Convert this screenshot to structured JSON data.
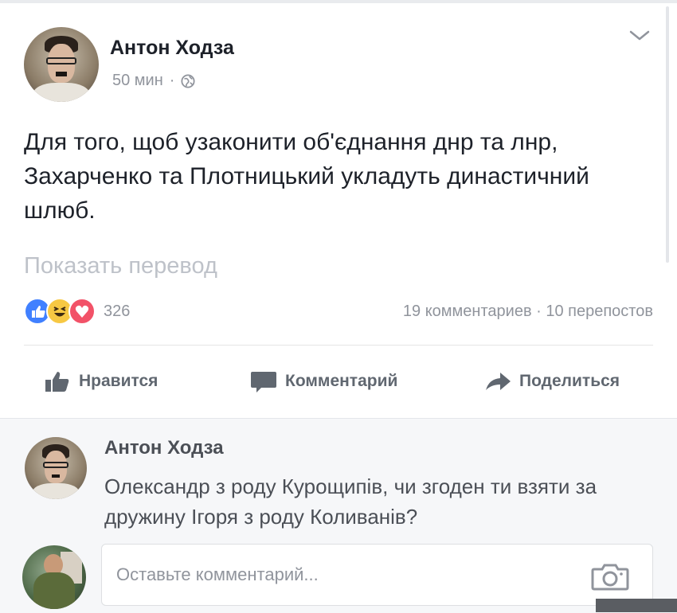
{
  "post": {
    "author": "Антон Ходза",
    "time": "50 мин",
    "separator": "·",
    "text": "Для того, щоб узаконити об'єднання днр та лнр, Захарченко та Плотницький укладуть династичний шлюб.",
    "translate_link": "Показать перевод",
    "reaction_count": "326",
    "stats": "19 комментариев · 10 перепостов",
    "reactions": [
      "like",
      "haha",
      "love"
    ]
  },
  "actions": {
    "like": "Нравится",
    "comment": "Комментарий",
    "share": "Поделиться"
  },
  "comment": {
    "author": "Антон Ходза",
    "text": "Олександр з роду Курощипів, чи згоден ти взяти за дружину Ігоря з роду Коливанів?"
  },
  "composer": {
    "placeholder": "Оставьте комментарий..."
  },
  "icons": {
    "chevron": "chevron-down-icon",
    "globe": "globe-icon",
    "like": "thumbs-up-icon",
    "comment": "speech-bubble-icon",
    "share": "share-arrow-icon",
    "camera": "camera-icon"
  },
  "colors": {
    "like_blue": "#4080ff",
    "haha_yellow": "#f7c843",
    "love_red": "#f25268",
    "muted_text": "#90949c",
    "action_text": "#606770"
  }
}
